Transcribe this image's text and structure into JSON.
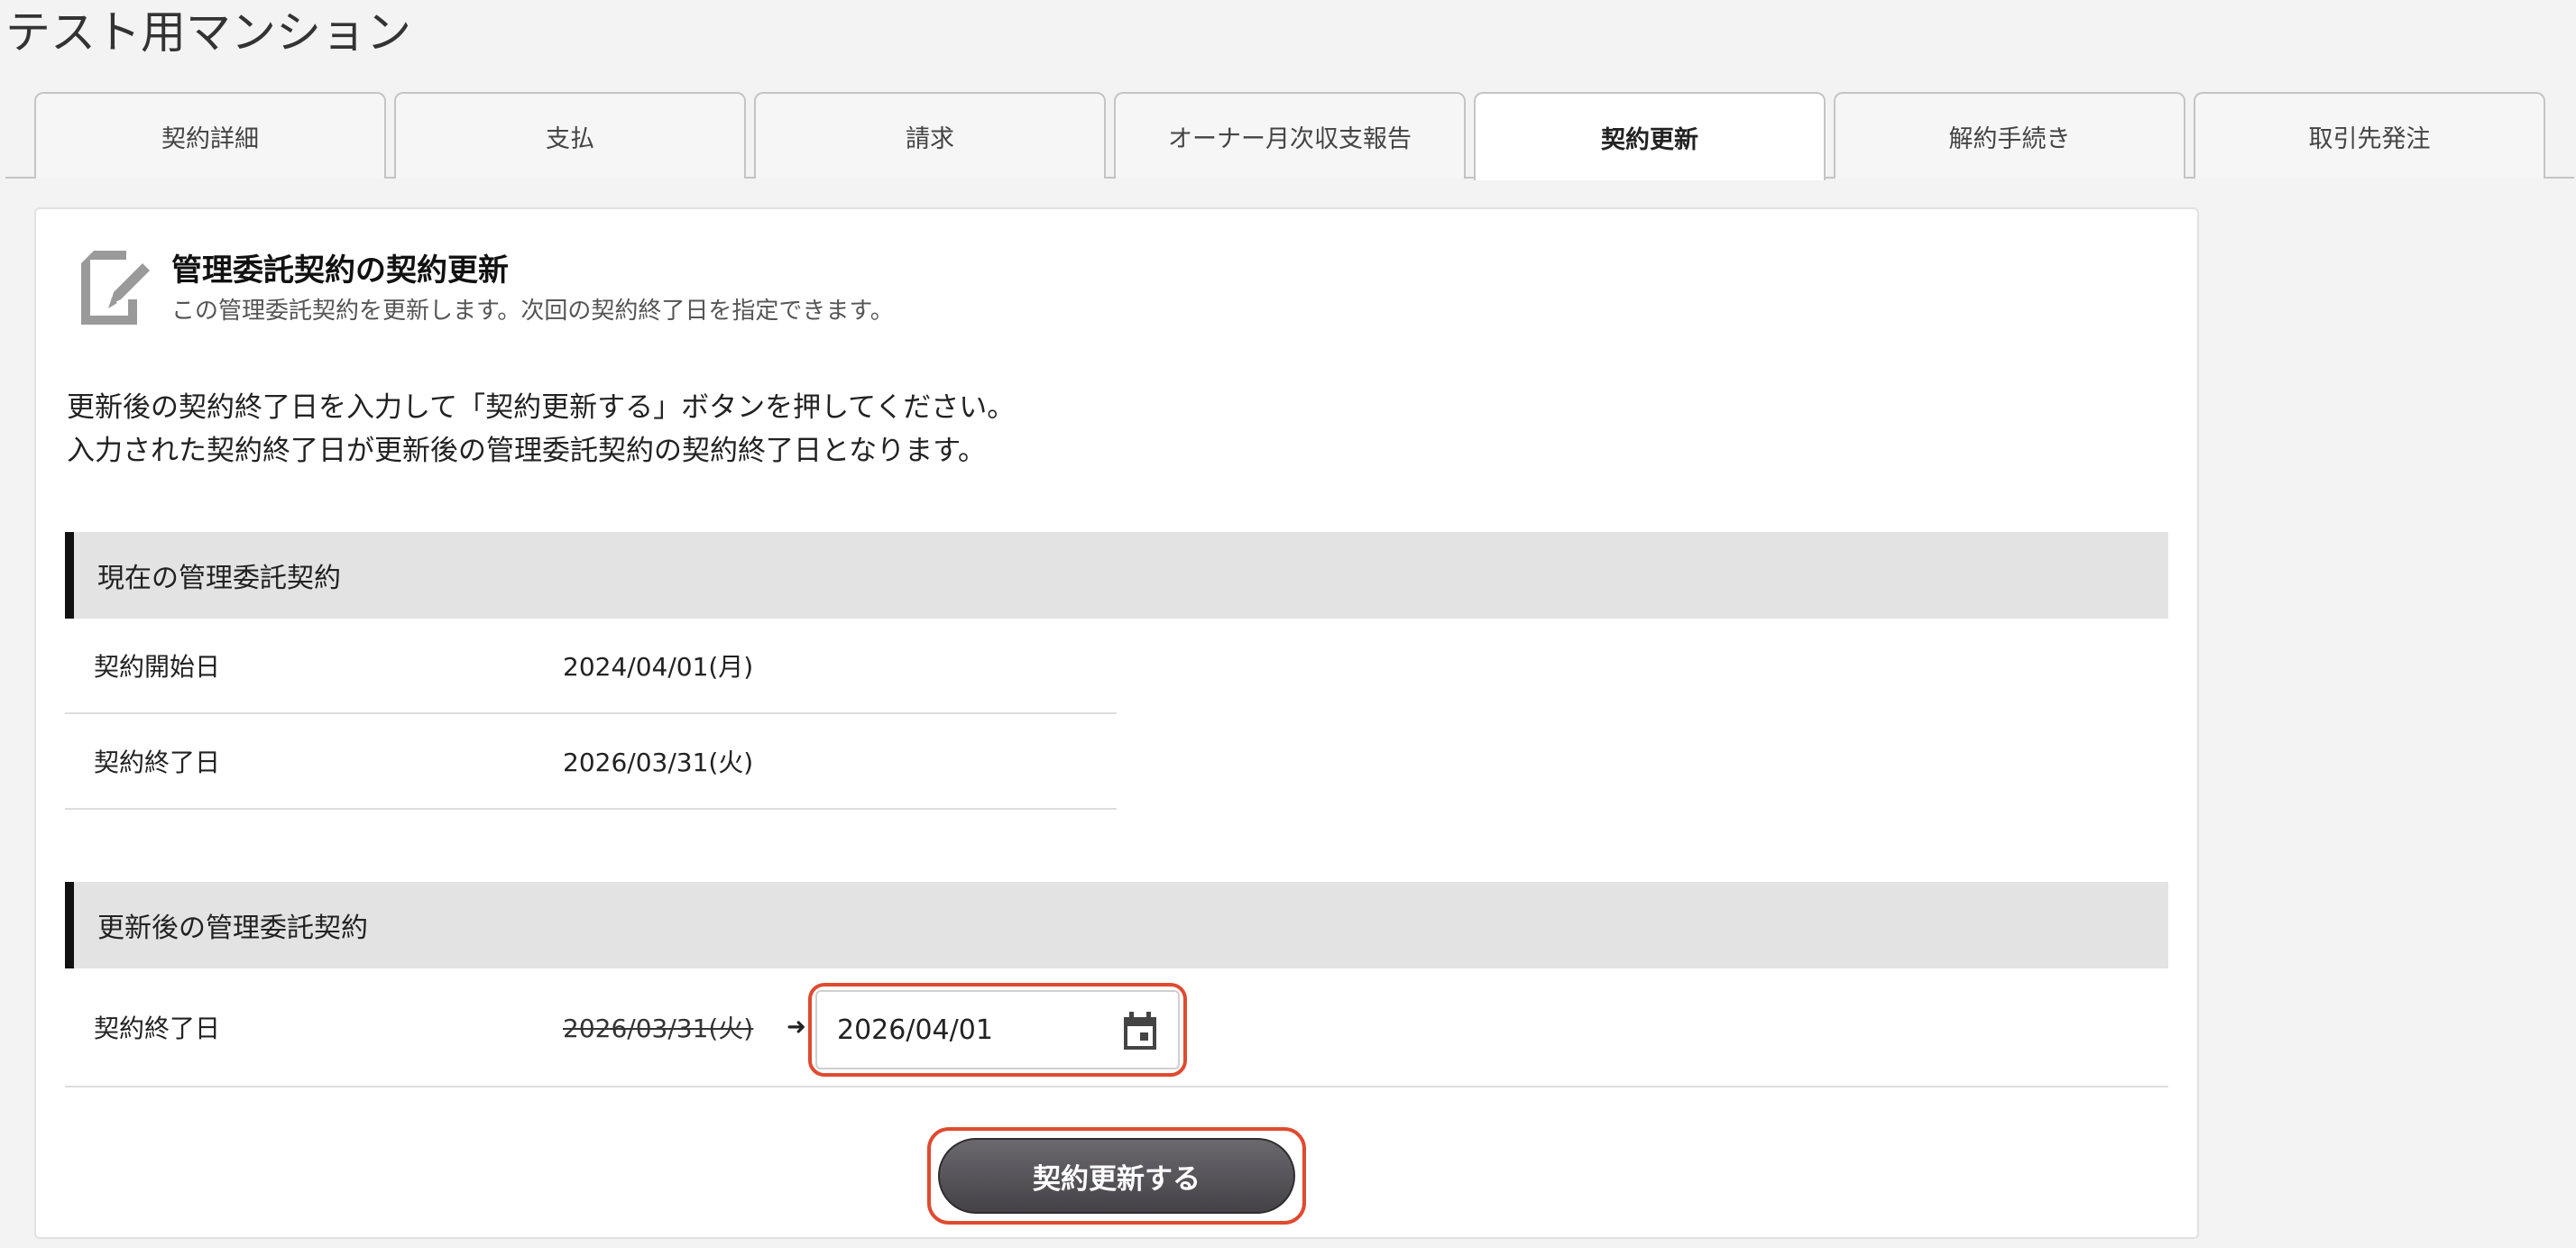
{
  "page": {
    "title": "テスト用マンション"
  },
  "tabs": [
    {
      "label": "契約詳細",
      "active": false
    },
    {
      "label": "支払",
      "active": false
    },
    {
      "label": "請求",
      "active": false
    },
    {
      "label": "オーナー月次収支報告",
      "active": false
    },
    {
      "label": "契約更新",
      "active": true
    },
    {
      "label": "解約手続き",
      "active": false
    },
    {
      "label": "取引先発注",
      "active": false
    }
  ],
  "card": {
    "icon": "edit-document-icon",
    "title": "管理委託契約の契約更新",
    "subtitle": "この管理委託契約を更新します。次回の契約終了日を指定できます。",
    "instruction_line1": "更新後の契約終了日を入力して「契約更新する」ボタンを押してください。",
    "instruction_line2": "入力された契約終了日が更新後の管理委託契約の契約終了日となります。"
  },
  "current_contract": {
    "heading": "現在の管理委託契約",
    "start_label": "契約開始日",
    "start_value": "2024/04/01(月)",
    "end_label": "契約終了日",
    "end_value": "2026/03/31(火)"
  },
  "renewed_contract": {
    "heading": "更新後の管理委託契約",
    "end_label": "契約終了日",
    "old_end_value": "2026/03/31(火)",
    "arrow": "➜",
    "new_end_value": "2026/04/01",
    "calendar_icon": "calendar-icon"
  },
  "actions": {
    "submit_label": "契約更新する"
  },
  "colors": {
    "highlight": "#e04a2f",
    "button": "#55525a",
    "section_bar": "#111111",
    "section_bg": "#e3e3e3"
  }
}
